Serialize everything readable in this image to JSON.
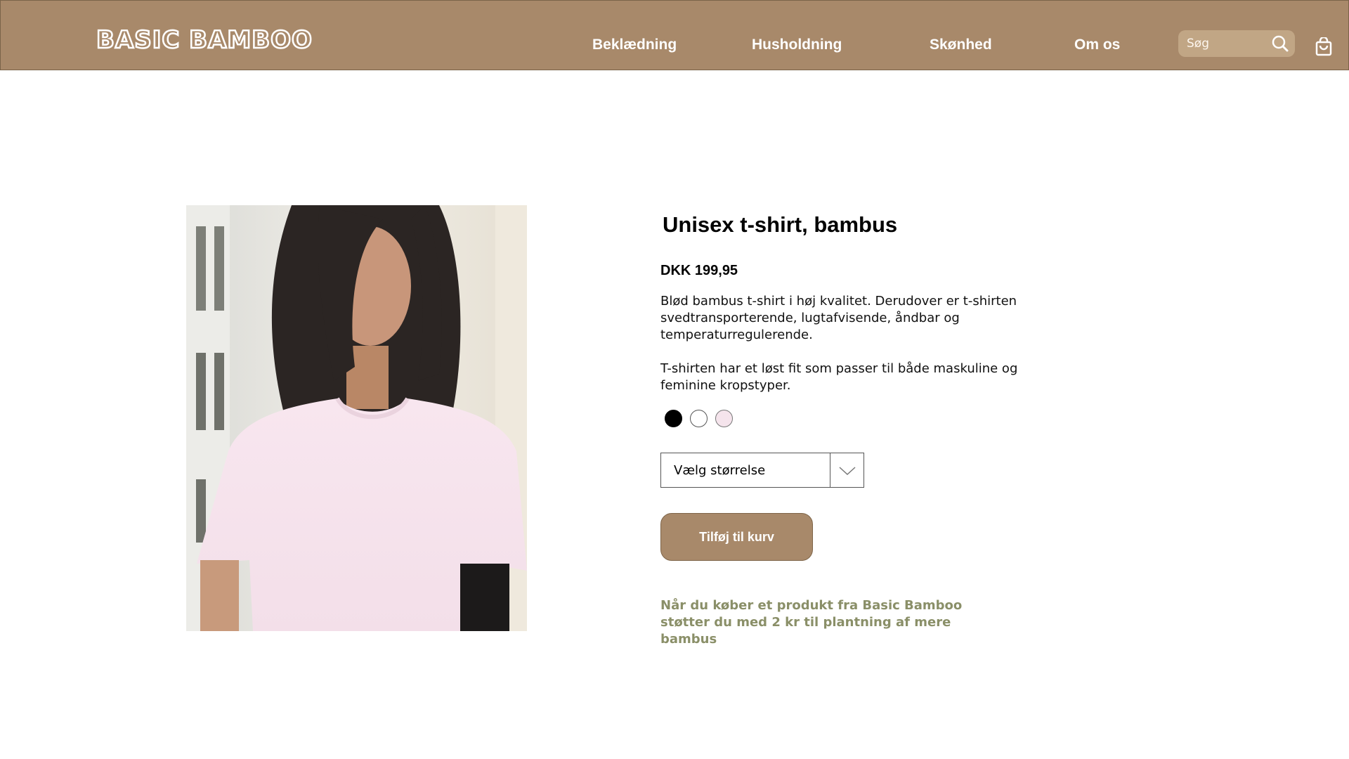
{
  "header": {
    "logo_text": "BASIC BAMBOO",
    "nav": [
      "Beklædning",
      "Husholdning",
      "Skønhed",
      "Om os"
    ],
    "search_placeholder": "Søg",
    "search_icon": "search-icon",
    "cart_icon": "shopping-bag-icon"
  },
  "product": {
    "title": "Unisex t-shirt, bambus",
    "price": "DKK 199,95",
    "description_1": "Blød bambus t-shirt i høj kvalitet. Derudover er t-shirten svedtransporterende, lugtafvisende, åndbar og temperaturregulerende.",
    "description_2": "T-shirten har et løst fit som passer til både maskuline og feminine kropstyper.",
    "colors": [
      {
        "name": "black",
        "hex": "#000000"
      },
      {
        "name": "white",
        "hex": "#ffffff"
      },
      {
        "name": "light pink",
        "hex": "#f5e4ec"
      }
    ],
    "size_select_label": "Vælg størrelse",
    "add_to_cart_label": "Tilføj til kurv",
    "note": "Når du køber et produkt fra Basic Bamboo støtter du med 2 kr til plantning af mere bambus"
  },
  "colors": {
    "brand": "#a8896a",
    "note": "#8a8f68"
  }
}
